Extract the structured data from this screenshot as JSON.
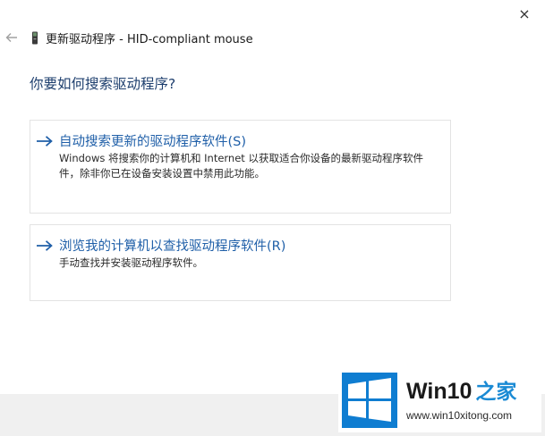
{
  "window": {
    "close_glyph": "×",
    "title": "更新驱动程序 - HID-compliant mouse"
  },
  "heading": "你要如何搜索驱动程序?",
  "options": [
    {
      "title": "自动搜索更新的驱动程序软件(S)",
      "desc_lines": [
        "Windows 将搜索你的计算机和 Internet 以获取适合你设备的最新驱动程序软件",
        "件，除非你已在设备安装设置中禁用此功能。"
      ]
    },
    {
      "title": "浏览我的计算机以查找驱动程序软件(R)",
      "desc_lines": [
        "手动查找并安装驱动程序软件。"
      ]
    }
  ],
  "watermark": {
    "brand_main": "Win10",
    "brand_accent": "之家",
    "url": "www.win10xitong.com"
  },
  "colors": {
    "heading": "#1e3f6e",
    "option_title": "#1f5fa8",
    "windows_logo": "#0f7dd1"
  },
  "icons": {
    "close": "close-icon",
    "back": "back-arrow-icon",
    "device": "device-icon",
    "option_arrow": "right-arrow-icon",
    "logo": "windows-logo-icon"
  }
}
